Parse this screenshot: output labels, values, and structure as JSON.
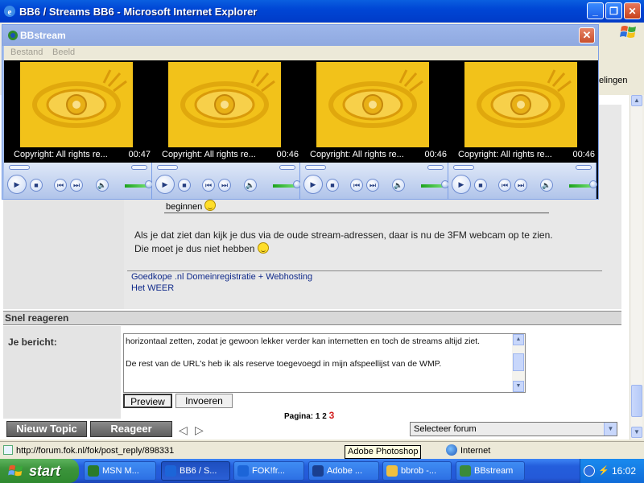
{
  "ie": {
    "title": "BB6 / Streams BB6 - Microsoft Internet Explorer",
    "mededelingen_fragment": "elingen",
    "status_url": "http://forum.fok.nl/fok/post_reply/898331",
    "status_zone": "Internet",
    "tooltip": "Adobe Photoshop"
  },
  "bbstream": {
    "title": "BBstream",
    "menu": [
      "Bestand",
      "Beeld"
    ],
    "players": [
      {
        "caption": "Copyright: All rights re...",
        "time": "00:47"
      },
      {
        "caption": "Copyright: All rights re...",
        "time": "00:46"
      },
      {
        "caption": "Copyright: All rights re...",
        "time": "00:46"
      },
      {
        "caption": "Copyright: All rights re...",
        "time": "00:46"
      }
    ]
  },
  "post": {
    "quote_fragment": "beginnen",
    "line1": "Als je dat ziet dan kijk je dus via de oude stream-adressen, daar is nu de 3FM webcam op te zien.",
    "line2": "Die moet je dus niet hebben",
    "sig_link1": "Goedkope .nl Domeinregistratie + Webhosting",
    "sig_link2": "Het WEER"
  },
  "reply": {
    "section_title": "Snel reageren",
    "label": "Je bericht:",
    "text_line1": "horizontaal zetten, zodat je gewoon lekker verder kan internetten en toch de streams altijd ziet.",
    "text_line2": "De rest van de URL's heb ik als reserve toegevoegd in mijn afspeellijst van de WMP.",
    "preview_label": "Preview",
    "invoeren_label": "Invoeren",
    "pagina_label": "Pagina:",
    "pages": [
      "1",
      "2"
    ],
    "current_page": "3",
    "nieuw_topic_label": "Nieuw Topic",
    "reageer_label": "Reageer",
    "forum_select": "Selecteer forum"
  },
  "taskbar": {
    "start_label": "start",
    "tasks": [
      {
        "label": "MSN M...",
        "color": "#2a7a2a"
      },
      {
        "label": "BB6 / S...",
        "color": "#1c65d8"
      },
      {
        "label": "FOK!fr...",
        "color": "#1c65d8"
      },
      {
        "label": "Adobe ...",
        "color": "#1a3f8f"
      },
      {
        "label": "bbrob -...",
        "color": "#f0c040"
      },
      {
        "label": "BBstream",
        "color": "#3a8a3a"
      }
    ],
    "clock": "16:02"
  },
  "colors": {
    "xp_blue": "#0046d5",
    "video_yellow": "#f2c21a",
    "link_blue": "#102a8a",
    "page_red": "#d21f1f"
  }
}
